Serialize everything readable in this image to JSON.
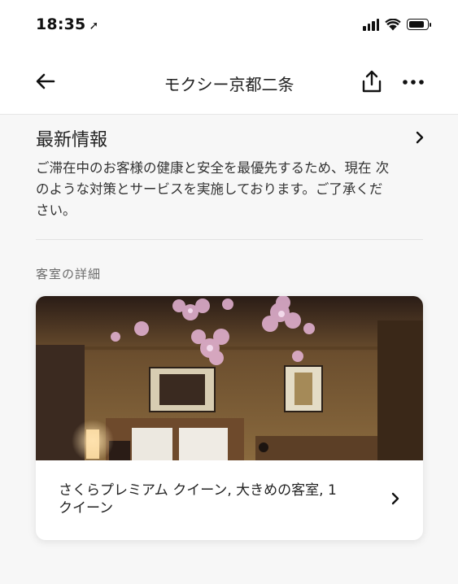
{
  "status_bar": {
    "time": "18:35",
    "location_arrow": "➚",
    "icons": [
      "location-arrow-icon",
      "cellular-signal-icon",
      "wifi-icon",
      "battery-icon"
    ]
  },
  "nav": {
    "title": "モクシー京都二条",
    "back_icon": "back-arrow-icon",
    "share_icon": "share-icon",
    "more_icon": "more-dots-icon"
  },
  "news": {
    "title": "最新情報",
    "body": "ご滞在中のお客様の健康と安全を最優先するため、現在 次のような対策とサービスを実施しております。ご了承ください。",
    "chevron_icon": "chevron-right-icon"
  },
  "rooms": {
    "section_label": "客室の詳細",
    "card": {
      "name": "さくらプレミアム クイーン, 大きめの客室, 1 クイーン",
      "image": "hotel-room-photo",
      "chevron_icon": "chevron-right-icon"
    }
  },
  "colors": {
    "background": "#f7f7f7",
    "header": "#ffffff",
    "text": "#222222",
    "muted": "#6b6b6b"
  }
}
